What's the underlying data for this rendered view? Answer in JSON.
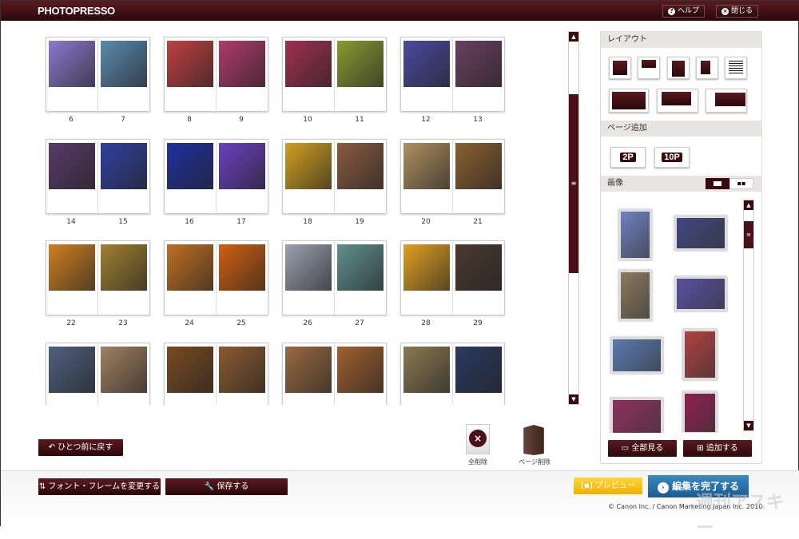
{
  "header": {
    "logo": "PHOTOPRESSO",
    "help": "ヘルプ",
    "close": "閉じる",
    "help_icon": "?",
    "close_icon": "×"
  },
  "spreads": [
    {
      "pages": [
        {
          "num": "6",
          "color": "#8a7ad0"
        },
        {
          "num": "7",
          "color": "#5a8ab0"
        }
      ]
    },
    {
      "pages": [
        {
          "num": "8",
          "color": "#c04040"
        },
        {
          "num": "9",
          "color": "#b03a6a"
        }
      ]
    },
    {
      "pages": [
        {
          "num": "10",
          "color": "#a03050"
        },
        {
          "num": "11",
          "color": "#8a9a30"
        }
      ]
    },
    {
      "pages": [
        {
          "num": "12",
          "color": "#4a4aa0"
        },
        {
          "num": "13",
          "color": "#6a4060"
        }
      ]
    },
    {
      "pages": [
        {
          "num": "14",
          "color": "#5a3a6a"
        },
        {
          "num": "15",
          "color": "#3040a0"
        }
      ]
    },
    {
      "pages": [
        {
          "num": "16",
          "color": "#2030a0"
        },
        {
          "num": "17",
          "color": "#6a40c0"
        }
      ]
    },
    {
      "pages": [
        {
          "num": "18",
          "color": "#d0a020"
        },
        {
          "num": "19",
          "color": "#8a5a40"
        }
      ]
    },
    {
      "pages": [
        {
          "num": "20",
          "color": "#b09060"
        },
        {
          "num": "21",
          "color": "#8a6030"
        }
      ]
    },
    {
      "pages": [
        {
          "num": "22",
          "color": "#d08020"
        },
        {
          "num": "23",
          "color": "#a08030"
        }
      ]
    },
    {
      "pages": [
        {
          "num": "24",
          "color": "#c07020"
        },
        {
          "num": "25",
          "color": "#d06010"
        }
      ]
    },
    {
      "pages": [
        {
          "num": "26",
          "color": "#9aa0b0"
        },
        {
          "num": "27",
          "color": "#609090"
        }
      ]
    },
    {
      "pages": [
        {
          "num": "28",
          "color": "#e0a020"
        },
        {
          "num": "29",
          "color": "#4a3a30"
        }
      ]
    },
    {
      "pages": [
        {
          "num": "",
          "color": "#506080"
        },
        {
          "num": "",
          "color": "#a08060"
        }
      ]
    },
    {
      "pages": [
        {
          "num": "",
          "color": "#7a4a20"
        },
        {
          "num": "",
          "color": "#8a5a30"
        }
      ]
    },
    {
      "pages": [
        {
          "num": "",
          "color": "#9a6a40"
        },
        {
          "num": "",
          "color": "#a06030"
        }
      ]
    },
    {
      "pages": [
        {
          "num": "",
          "color": "#8a7a50"
        },
        {
          "num": "",
          "color": "#2a3a60"
        }
      ]
    }
  ],
  "panel": {
    "layout_title": "レイアウト",
    "add_page_title": "ページ追加",
    "add_2p": "2P",
    "add_10p": "10P",
    "images_title": "画像",
    "images": [
      {
        "color": "#7080c0"
      },
      {
        "color": "#404880"
      },
      {
        "color": "#8a7a60"
      },
      {
        "color": "#5a50a0"
      },
      {
        "color": "#5a7ab0"
      },
      {
        "color": "#b04040"
      },
      {
        "color": "#903060"
      },
      {
        "color": "#902050"
      }
    ],
    "view_all": "全部見る",
    "add": "追加する"
  },
  "actions": {
    "undo": "ひとつ前に戻す",
    "delete_all": "全削除",
    "delete_page": "ページ削除",
    "change_font": "フォント・フレームを変更する",
    "save": "保存する",
    "preview": "プレビュー",
    "finish": "編集を完了する"
  },
  "footer": {
    "copyright": "© Canon Inc. / Canon Marketing Japan Inc. 2010",
    "watermark": "週刊アスキー"
  }
}
